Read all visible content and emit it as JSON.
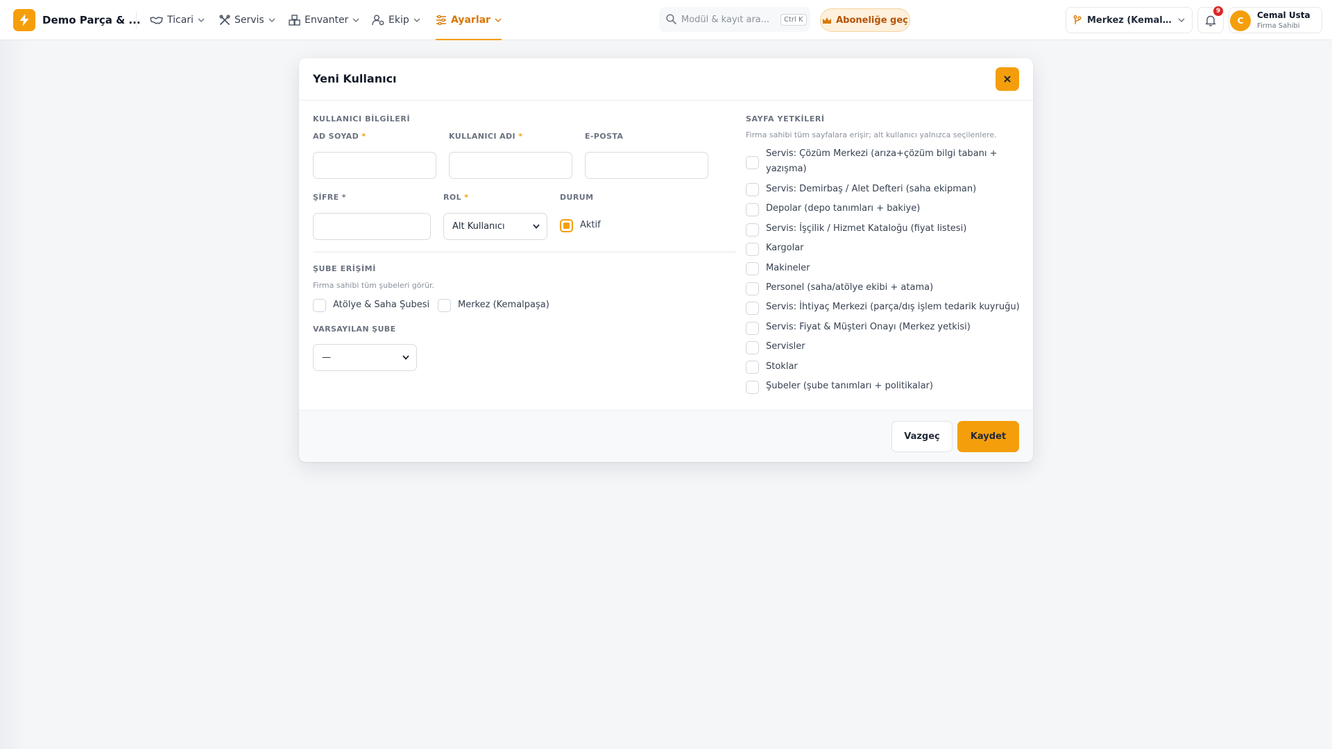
{
  "brand": {
    "name": "Demo Parça & ..."
  },
  "nav": {
    "items": [
      {
        "label": "Ticari",
        "icon": "handshake-icon"
      },
      {
        "label": "Servis",
        "icon": "tools-icon"
      },
      {
        "label": "Envanter",
        "icon": "boxes-icon"
      },
      {
        "label": "Ekip",
        "icon": "user-cog-icon"
      },
      {
        "label": "Ayarlar",
        "icon": "sliders-icon",
        "active": true
      }
    ]
  },
  "search": {
    "placeholder": "Modül & kayıt ara...",
    "shortcut": "Ctrl K"
  },
  "upgrade": {
    "label": "Aboneliğe geç"
  },
  "branch": {
    "label": "Merkez (Kemalpa..."
  },
  "notifications": {
    "count": "9"
  },
  "user": {
    "initial": "C",
    "name": "Cemal Usta",
    "role": "Firma Sahibi"
  },
  "modal": {
    "title": "Yeni Kullanıcı",
    "user_info": {
      "section_title": "KULLANICI BİLGİLERİ",
      "full_name_label": "AD SOYAD",
      "username_label": "KULLANICI ADI",
      "email_label": "E-POSTA",
      "password_label": "ŞİFRE",
      "role_label": "ROL",
      "role_value": "Alt Kullanıcı",
      "status_label": "DURUM",
      "status_value": "Aktif",
      "required_mark": "*"
    },
    "branch_access": {
      "section_title": "ŞUBE ERİŞİMİ",
      "helper": "Firma sahibi tüm şubeleri görür.",
      "options": [
        {
          "label": "Atölye & Saha Şubesi",
          "checked": false
        },
        {
          "label": "Merkez (Kemalpaşa)",
          "checked": false
        }
      ],
      "default_branch_label": "VARSAYILAN ŞUBE",
      "default_branch_value": "—"
    },
    "page_permissions": {
      "section_title": "SAYFA YETKİLERİ",
      "helper": "Firma sahibi tüm sayfalara erişir; alt kullanıcı yalnızca seçilenlere.",
      "items": [
        {
          "label": "Servis: Çözüm Merkezi (arıza+çözüm bilgi tabanı + yazışma)",
          "checked": false
        },
        {
          "label": "Servis: Demirbaş / Alet Defteri (saha ekipman)",
          "checked": false
        },
        {
          "label": "Depolar (depo tanımları + bakiye)",
          "checked": false
        },
        {
          "label": "Servis: İşçilik / Hizmet Kataloğu (fiyat listesi)",
          "checked": false
        },
        {
          "label": "Kargolar",
          "checked": false
        },
        {
          "label": "Makineler",
          "checked": false
        },
        {
          "label": "Personel (saha/atölye ekibi + atama)",
          "checked": false
        },
        {
          "label": "Servis: İhtiyaç Merkezi (parça/dış işlem tedarik kuyruğu)",
          "checked": false
        },
        {
          "label": "Servis: Fiyat & Müşteri Onayı (Merkez yetkisi)",
          "checked": false
        },
        {
          "label": "Servisler",
          "checked": false
        },
        {
          "label": "Stoklar",
          "checked": false
        },
        {
          "label": "Şubeler (şube tanımları + politikalar)",
          "checked": false
        }
      ]
    },
    "footer": {
      "cancel_label": "Vazgeç",
      "save_label": "Kaydet"
    }
  },
  "colors": {
    "accent": "#f59e0b",
    "accent_text": "#d97706",
    "badge": "#dc2626"
  }
}
